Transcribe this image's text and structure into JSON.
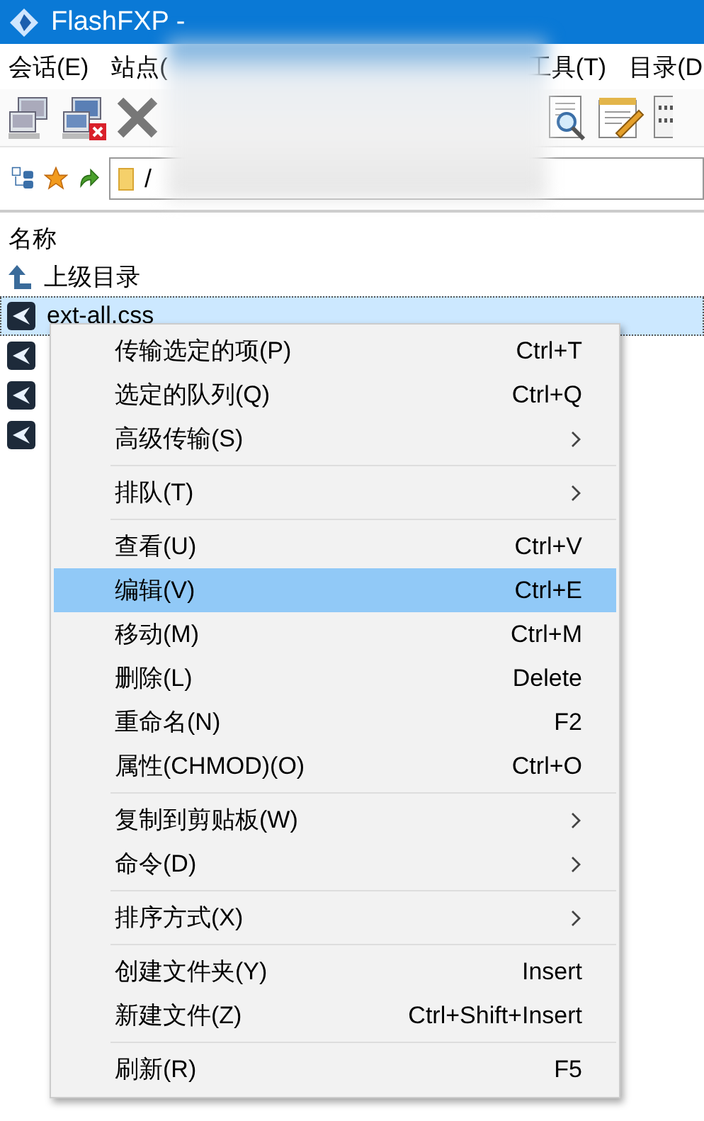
{
  "window": {
    "title": "FlashFXP -"
  },
  "menu_bar": [
    {
      "label": "会话(E)"
    },
    {
      "label": "站点("
    },
    {
      "label": "工具(T)"
    },
    {
      "label": "目录(D"
    }
  ],
  "address": {
    "value": "/"
  },
  "file_list": {
    "columns": [
      "名称"
    ],
    "rows": [
      {
        "kind": "parent",
        "name": "上级目录",
        "selected": false
      },
      {
        "kind": "file",
        "name": "ext-all.css",
        "selected": true
      },
      {
        "kind": "file",
        "selected": false
      },
      {
        "kind": "file",
        "selected": false
      },
      {
        "kind": "file",
        "selected": false
      }
    ]
  },
  "context_menu": [
    {
      "kind": "item",
      "label": "传输选定的项(P)",
      "shortcut": "Ctrl+T",
      "submenu": false,
      "selected": false
    },
    {
      "kind": "item",
      "label": "选定的队列(Q)",
      "shortcut": "Ctrl+Q",
      "submenu": false,
      "selected": false
    },
    {
      "kind": "item",
      "label": "高级传输(S)",
      "submenu": true,
      "selected": false
    },
    {
      "kind": "separator"
    },
    {
      "kind": "item",
      "label": "排队(T)",
      "submenu": true,
      "selected": false
    },
    {
      "kind": "separator"
    },
    {
      "kind": "item",
      "label": "查看(U)",
      "shortcut": "Ctrl+V",
      "submenu": false,
      "selected": false
    },
    {
      "kind": "item",
      "label": "编辑(V)",
      "shortcut": "Ctrl+E",
      "submenu": false,
      "selected": true
    },
    {
      "kind": "item",
      "label": "移动(M)",
      "shortcut": "Ctrl+M",
      "submenu": false,
      "selected": false
    },
    {
      "kind": "item",
      "label": "删除(L)",
      "shortcut": "Delete",
      "submenu": false,
      "selected": false
    },
    {
      "kind": "item",
      "label": "重命名(N)",
      "shortcut": "F2",
      "submenu": false,
      "selected": false
    },
    {
      "kind": "item",
      "label": "属性(CHMOD)(O)",
      "shortcut": "Ctrl+O",
      "submenu": false,
      "selected": false
    },
    {
      "kind": "separator"
    },
    {
      "kind": "item",
      "label": "复制到剪贴板(W)",
      "submenu": true,
      "selected": false
    },
    {
      "kind": "item",
      "label": "命令(D)",
      "submenu": true,
      "selected": false
    },
    {
      "kind": "separator"
    },
    {
      "kind": "item",
      "label": "排序方式(X)",
      "submenu": true,
      "selected": false
    },
    {
      "kind": "separator"
    },
    {
      "kind": "item",
      "label": "创建文件夹(Y)",
      "shortcut": "Insert",
      "submenu": false,
      "selected": false
    },
    {
      "kind": "item",
      "label": "新建文件(Z)",
      "shortcut": "Ctrl+Shift+Insert",
      "submenu": false,
      "selected": false
    },
    {
      "kind": "separator"
    },
    {
      "kind": "item",
      "label": "刷新(R)",
      "shortcut": "F5",
      "submenu": false,
      "selected": false
    }
  ]
}
